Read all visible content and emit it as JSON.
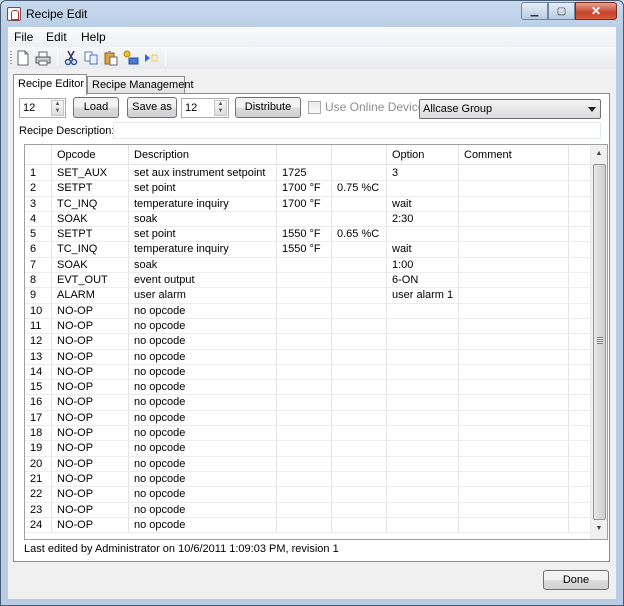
{
  "window": {
    "title": "Recipe Edit",
    "minimize": "▁",
    "maximize": "▢",
    "close": "✕"
  },
  "menu": [
    "File",
    "Edit",
    "Help"
  ],
  "toolbar": [
    "new-icon",
    "print-icon",
    "cut-icon",
    "copy-icon",
    "paste-icon",
    "insert-row-icon",
    "run-icon"
  ],
  "tabs": [
    {
      "label": "Recipe Editor",
      "active": true
    },
    {
      "label": "Recipe Management",
      "active": false
    }
  ],
  "controls": {
    "load_spin": "12",
    "load_button": "Load",
    "save_as_button": "Save as",
    "save_spin": "12",
    "distribute_button": "Distribute",
    "use_online_device": "Use Online Device",
    "use_online_checked": false,
    "group_select": "Allcase Group",
    "description_label": "Recipe Description:",
    "description_value": ""
  },
  "grid": {
    "columns": [
      "",
      "Opcode",
      "Description",
      "",
      "",
      "Option",
      "Comment"
    ],
    "rows": [
      [
        "1",
        "SET_AUX",
        "set aux instrument setpoint",
        "1725",
        "",
        "3",
        ""
      ],
      [
        "2",
        "SETPT",
        "set point",
        "1700 °F",
        "0.75 %C",
        "",
        ""
      ],
      [
        "3",
        "TC_INQ",
        "temperature inquiry",
        "1700 °F",
        "",
        "wait",
        ""
      ],
      [
        "4",
        "SOAK",
        "soak",
        "",
        "",
        "2:30",
        ""
      ],
      [
        "5",
        "SETPT",
        "set point",
        "1550 °F",
        "0.65 %C",
        "",
        ""
      ],
      [
        "6",
        "TC_INQ",
        "temperature inquiry",
        "1550 °F",
        "",
        "wait",
        ""
      ],
      [
        "7",
        "SOAK",
        "soak",
        "",
        "",
        "1:00",
        ""
      ],
      [
        "8",
        "EVT_OUT",
        "event output",
        "",
        "",
        "6-ON",
        ""
      ],
      [
        "9",
        "ALARM",
        "user alarm",
        "",
        "",
        "user alarm 1",
        ""
      ],
      [
        "10",
        "NO-OP",
        "no opcode",
        "",
        "",
        "",
        ""
      ],
      [
        "11",
        "NO-OP",
        "no opcode",
        "",
        "",
        "",
        ""
      ],
      [
        "12",
        "NO-OP",
        "no opcode",
        "",
        "",
        "",
        ""
      ],
      [
        "13",
        "NO-OP",
        "no opcode",
        "",
        "",
        "",
        ""
      ],
      [
        "14",
        "NO-OP",
        "no opcode",
        "",
        "",
        "",
        ""
      ],
      [
        "15",
        "NO-OP",
        "no opcode",
        "",
        "",
        "",
        ""
      ],
      [
        "16",
        "NO-OP",
        "no opcode",
        "",
        "",
        "",
        ""
      ],
      [
        "17",
        "NO-OP",
        "no opcode",
        "",
        "",
        "",
        ""
      ],
      [
        "18",
        "NO-OP",
        "no opcode",
        "",
        "",
        "",
        ""
      ],
      [
        "19",
        "NO-OP",
        "no opcode",
        "",
        "",
        "",
        ""
      ],
      [
        "20",
        "NO-OP",
        "no opcode",
        "",
        "",
        "",
        ""
      ],
      [
        "21",
        "NO-OP",
        "no opcode",
        "",
        "",
        "",
        ""
      ],
      [
        "22",
        "NO-OP",
        "no opcode",
        "",
        "",
        "",
        ""
      ],
      [
        "23",
        "NO-OP",
        "no opcode",
        "",
        "",
        "",
        ""
      ],
      [
        "24",
        "NO-OP",
        "no opcode",
        "",
        "",
        "",
        ""
      ]
    ]
  },
  "status": "Last edited by Administrator on 10/6/2011 1:09:03 PM, revision 1",
  "done_button": "Done"
}
